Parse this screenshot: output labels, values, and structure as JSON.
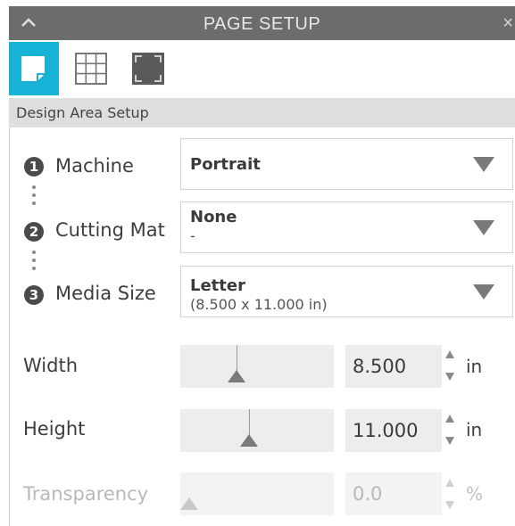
{
  "panel": {
    "title": "PAGE SETUP",
    "close_label": "×"
  },
  "tools": [
    {
      "name": "page-icon",
      "active": true
    },
    {
      "name": "grid-icon",
      "active": false
    },
    {
      "name": "fit-screen-icon",
      "active": false
    }
  ],
  "section": {
    "title": "Design Area Setup"
  },
  "steps": [
    {
      "number": "1",
      "label": "Machine",
      "main": "Portrait",
      "sub": ""
    },
    {
      "number": "2",
      "label": "Cutting Mat",
      "main": "None",
      "sub": "-"
    },
    {
      "number": "3",
      "label": "Media Size",
      "main": "Letter",
      "sub": "(8.500 x 11.000 in)"
    }
  ],
  "width": {
    "label": "Width",
    "value": "8.500",
    "unit": "in",
    "slider_fraction": 0.35
  },
  "height": {
    "label": "Height",
    "value": "11.000",
    "unit": "in",
    "slider_fraction": 0.44
  },
  "transparency": {
    "label": "Transparency",
    "value": "0.0",
    "unit": "%",
    "slider_fraction": 0.0,
    "disabled": true
  },
  "colors": {
    "accent": "#17b2d6",
    "titlebar": "#6c6c6c",
    "section_bg": "#dedede"
  }
}
